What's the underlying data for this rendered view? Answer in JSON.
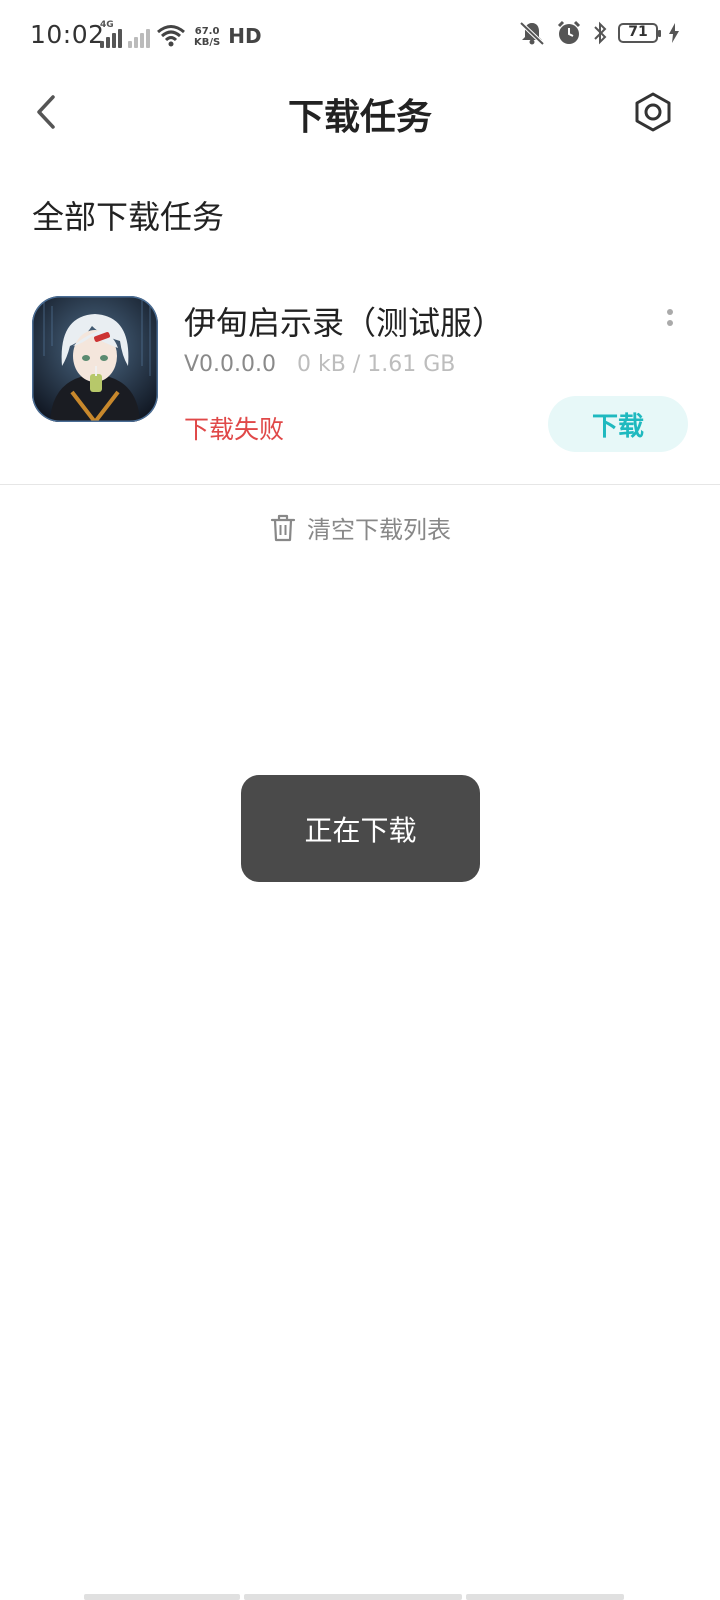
{
  "status_bar": {
    "time": "10:02",
    "net_tag": "4G",
    "speed_value": "67.0",
    "speed_unit": "KB/S",
    "hd_label": "HD",
    "battery_level": "71",
    "icons": [
      "signal-icon",
      "wifi-icon",
      "mute-icon",
      "alarm-icon",
      "bluetooth-icon",
      "battery-icon",
      "charging-icon"
    ]
  },
  "header": {
    "title": "下载任务",
    "back_icon": "back-arrow-icon",
    "settings_icon": "settings-hexagon-icon"
  },
  "section_title": "全部下载任务",
  "task": {
    "name": "伊甸启示录（测试服）",
    "version": "V0.0.0.0",
    "size": "0 kB / 1.61 GB",
    "status": "下载失败",
    "status_color": "#e04848",
    "button_label": "下载",
    "button_color": "#1fb9bf"
  },
  "clear_list_label": "清空下载列表",
  "toast": "正在下载"
}
